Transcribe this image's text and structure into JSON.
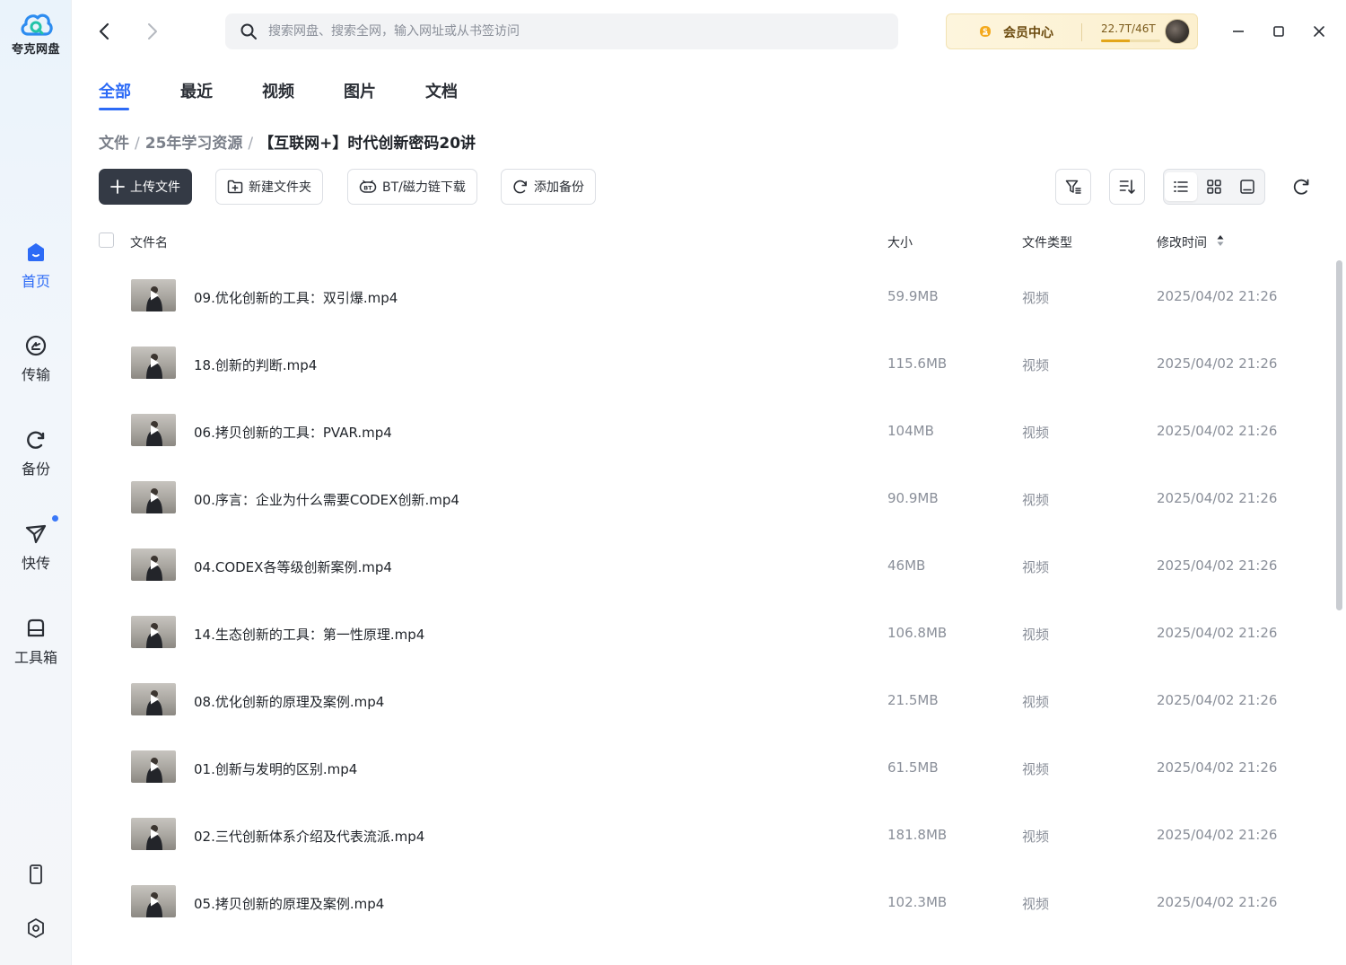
{
  "app": {
    "name": "夸克网盘"
  },
  "sidebar": {
    "items": [
      {
        "label": "首页",
        "icon": "home-icon",
        "active": true
      },
      {
        "label": "传输",
        "icon": "transfer-icon",
        "active": false
      },
      {
        "label": "备份",
        "icon": "backup-icon",
        "active": false
      },
      {
        "label": "快传",
        "icon": "quick-send-icon",
        "active": false,
        "badge_dot": true
      },
      {
        "label": "工具箱",
        "icon": "toolbox-icon",
        "active": false
      }
    ]
  },
  "header": {
    "search_placeholder": "搜索网盘、搜索全网，输入网址或从书签访问",
    "vip_label": "会员中心",
    "storage_text": "22.7T/46T",
    "storage_used_fraction": 0.49
  },
  "tabs": [
    {
      "label": "全部",
      "active": true
    },
    {
      "label": "最近",
      "active": false
    },
    {
      "label": "视频",
      "active": false
    },
    {
      "label": "图片",
      "active": false
    },
    {
      "label": "文档",
      "active": false
    }
  ],
  "breadcrumb": {
    "items": [
      "文件",
      "25年学习资源"
    ],
    "separator": "/",
    "current": "【互联网+】时代创新密码20讲"
  },
  "toolbar": {
    "upload_label": "上传文件",
    "new_folder_label": "新建文件夹",
    "bt_label": "BT/磁力链下载",
    "backup_label": "添加备份"
  },
  "table": {
    "columns": {
      "name": "文件名",
      "size": "大小",
      "type": "文件类型",
      "modified": "修改时间"
    },
    "rows": [
      {
        "name": "09.优化创新的工具：双引爆.mp4",
        "size": "59.9MB",
        "type": "视频",
        "modified": "2025/04/02 21:26"
      },
      {
        "name": "18.创新的判断.mp4",
        "size": "115.6MB",
        "type": "视频",
        "modified": "2025/04/02 21:26"
      },
      {
        "name": "06.拷贝创新的工具：PVAR.mp4",
        "size": "104MB",
        "type": "视频",
        "modified": "2025/04/02 21:26"
      },
      {
        "name": "00.序言：企业为什么需要CODEX创新.mp4",
        "size": "90.9MB",
        "type": "视频",
        "modified": "2025/04/02 21:26"
      },
      {
        "name": "04.CODEX各等级创新案例.mp4",
        "size": "46MB",
        "type": "视频",
        "modified": "2025/04/02 21:26"
      },
      {
        "name": "14.生态创新的工具：第一性原理.mp4",
        "size": "106.8MB",
        "type": "视频",
        "modified": "2025/04/02 21:26"
      },
      {
        "name": "08.优化创新的原理及案例.mp4",
        "size": "21.5MB",
        "type": "视频",
        "modified": "2025/04/02 21:26"
      },
      {
        "name": "01.创新与发明的区别.mp4",
        "size": "61.5MB",
        "type": "视频",
        "modified": "2025/04/02 21:26"
      },
      {
        "name": "02.三代创新体系介绍及代表流派.mp4",
        "size": "181.8MB",
        "type": "视频",
        "modified": "2025/04/02 21:26"
      },
      {
        "name": "05.拷贝创新的原理及案例.mp4",
        "size": "102.3MB",
        "type": "视频",
        "modified": "2025/04/02 21:26"
      }
    ]
  }
}
